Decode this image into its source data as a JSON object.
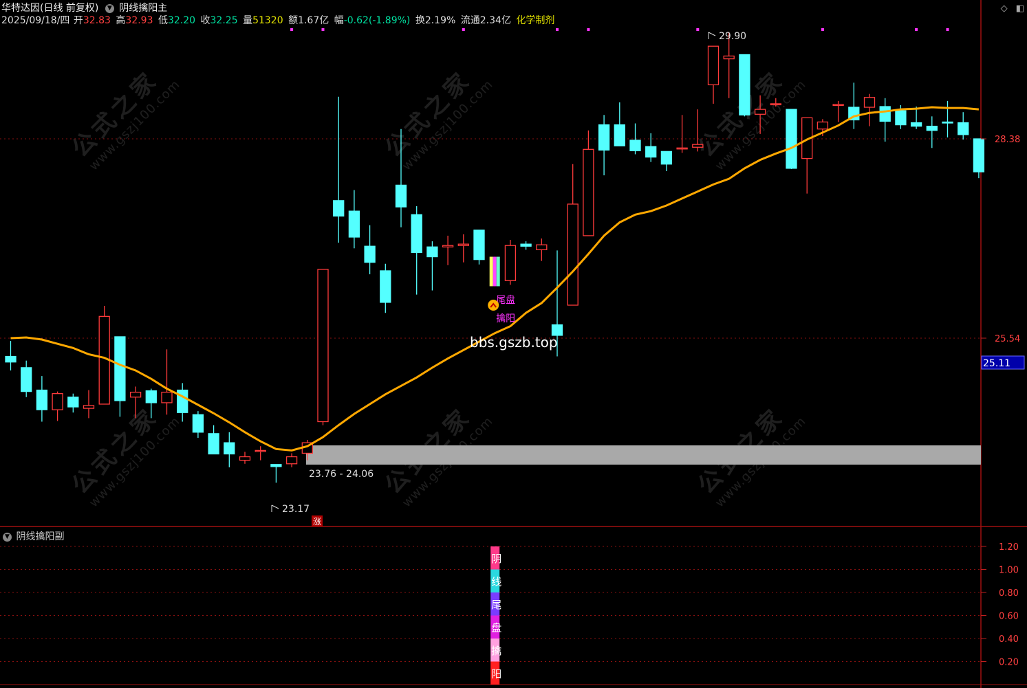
{
  "header": {
    "stock_name": "华特达因(日线 前复权)",
    "indicator_name": "阴线擒阳主",
    "date": "2025/09/18/四",
    "open_label": "开",
    "open": "32.83",
    "high_label": "高",
    "high": "32.93",
    "low_label": "低",
    "low": "32.20",
    "close_label": "收",
    "close": "32.25",
    "volume_label": "量",
    "volume": "51320",
    "amount_label": "额",
    "amount": "1.67亿",
    "change_label": "幅",
    "change": "-0.62(-1.89%)",
    "turnover_label": "换",
    "turnover": "2.19%",
    "float_label": "流通",
    "float": "2.34亿",
    "sector": "化学制剂",
    "icons": [
      "diamond-icon",
      "window-icon"
    ]
  },
  "watermark": {
    "cn": "公式之家",
    "url": "www.gszj100.com"
  },
  "overlay_text": "bbs.gszb.top",
  "sub_panel": {
    "title": "阴线擒阳副"
  },
  "colors": {
    "up": "#ff3b3b",
    "down": "#54ffff",
    "ma": "#ffa800",
    "grid": "#8a1010",
    "magenta": "#ff33ff"
  },
  "chart_data": [
    {
      "type": "candlestick",
      "title": "",
      "y_ticks": [
        "28.38",
        "25.54"
      ],
      "current_price_tag": "25.11",
      "annotations": {
        "high_mark": "29.90",
        "low_mark": "23.17",
        "zone_label": "23.76 - 24.06",
        "signal_top": "尾盘",
        "signal_bottom": "擒阳",
        "limit_up_tag": "涨"
      },
      "zone": [
        23.76,
        24.06
      ],
      "candles": [
        {
          "o": 25.28,
          "h": 25.5,
          "l": 25.08,
          "c": 25.2
        },
        {
          "o": 25.12,
          "h": 25.22,
          "l": 24.7,
          "c": 24.78
        },
        {
          "o": 24.8,
          "h": 25.0,
          "l": 24.35,
          "c": 24.52
        },
        {
          "o": 24.52,
          "h": 24.78,
          "l": 24.36,
          "c": 24.75
        },
        {
          "o": 24.7,
          "h": 24.75,
          "l": 24.48,
          "c": 24.56
        },
        {
          "o": 24.54,
          "h": 24.8,
          "l": 24.4,
          "c": 24.58
        },
        {
          "o": 24.6,
          "h": 26.0,
          "l": 24.6,
          "c": 25.85
        },
        {
          "o": 25.56,
          "h": 25.56,
          "l": 24.42,
          "c": 24.65
        },
        {
          "o": 24.7,
          "h": 24.85,
          "l": 24.4,
          "c": 24.77
        },
        {
          "o": 24.79,
          "h": 24.82,
          "l": 24.4,
          "c": 24.62
        },
        {
          "o": 24.62,
          "h": 25.38,
          "l": 24.45,
          "c": 24.77
        },
        {
          "o": 24.8,
          "h": 24.9,
          "l": 24.35,
          "c": 24.48
        },
        {
          "o": 24.45,
          "h": 24.5,
          "l": 24.12,
          "c": 24.2
        },
        {
          "o": 24.18,
          "h": 24.3,
          "l": 23.98,
          "c": 23.89
        },
        {
          "o": 24.05,
          "h": 24.2,
          "l": 23.7,
          "c": 23.89
        },
        {
          "o": 23.8,
          "h": 23.92,
          "l": 23.75,
          "c": 23.85
        },
        {
          "o": 23.94,
          "h": 24.0,
          "l": 23.8,
          "c": 23.94
        },
        {
          "o": 23.74,
          "h": 23.74,
          "l": 23.48,
          "c": 23.71
        },
        {
          "o": 23.75,
          "h": 23.9,
          "l": 23.7,
          "c": 23.85
        },
        {
          "o": 23.9,
          "h": 24.09,
          "l": 23.8,
          "c": 24.05
        },
        {
          "o": 24.35,
          "h": 26.52,
          "l": 24.3,
          "c": 26.52
        },
        {
          "o": 27.5,
          "h": 28.98,
          "l": 26.9,
          "c": 27.28
        },
        {
          "o": 27.35,
          "h": 27.65,
          "l": 26.82,
          "c": 26.98
        },
        {
          "o": 26.85,
          "h": 27.15,
          "l": 26.45,
          "c": 26.62
        },
        {
          "o": 26.5,
          "h": 26.6,
          "l": 25.9,
          "c": 26.05
        },
        {
          "o": 27.72,
          "h": 28.52,
          "l": 27.12,
          "c": 27.41
        },
        {
          "o": 27.3,
          "h": 27.42,
          "l": 26.16,
          "c": 26.76
        },
        {
          "o": 26.84,
          "h": 26.92,
          "l": 26.22,
          "c": 26.7
        },
        {
          "o": 26.84,
          "h": 27.0,
          "l": 26.58,
          "c": 26.86
        },
        {
          "o": 26.86,
          "h": 27.02,
          "l": 26.62,
          "c": 26.88
        },
        {
          "o": 27.08,
          "h": 27.08,
          "l": 26.59,
          "c": 26.66
        },
        {
          "o": 26.7,
          "h": 26.7,
          "l": 26.28,
          "c": 26.28
        },
        {
          "o": 26.36,
          "h": 26.94,
          "l": 26.3,
          "c": 26.86
        },
        {
          "o": 26.88,
          "h": 26.92,
          "l": 26.8,
          "c": 26.85
        },
        {
          "o": 26.8,
          "h": 26.96,
          "l": 26.64,
          "c": 26.87
        },
        {
          "o": 25.73,
          "h": 26.79,
          "l": 25.28,
          "c": 25.58
        },
        {
          "o": 26.01,
          "h": 28.02,
          "l": 26.02,
          "c": 27.45
        },
        {
          "o": 27.0,
          "h": 28.5,
          "l": 27.0,
          "c": 28.23
        },
        {
          "o": 28.58,
          "h": 28.72,
          "l": 27.86,
          "c": 28.22
        },
        {
          "o": 28.58,
          "h": 28.9,
          "l": 28.38,
          "c": 28.28
        },
        {
          "o": 28.36,
          "h": 28.6,
          "l": 28.16,
          "c": 28.21
        },
        {
          "o": 28.27,
          "h": 28.46,
          "l": 28.05,
          "c": 28.12
        },
        {
          "o": 28.2,
          "h": 28.2,
          "l": 27.92,
          "c": 28.02
        },
        {
          "o": 28.24,
          "h": 28.72,
          "l": 28.18,
          "c": 28.25
        },
        {
          "o": 28.26,
          "h": 28.8,
          "l": 28.2,
          "c": 28.3
        },
        {
          "o": 29.15,
          "h": 29.6,
          "l": 28.88,
          "c": 29.7
        },
        {
          "o": 29.52,
          "h": 29.9,
          "l": 28.96,
          "c": 29.56
        },
        {
          "o": 29.58,
          "h": 29.58,
          "l": 28.7,
          "c": 28.72
        },
        {
          "o": 28.73,
          "h": 29.0,
          "l": 28.45,
          "c": 28.8
        },
        {
          "o": 28.87,
          "h": 28.96,
          "l": 28.84,
          "c": 28.88
        },
        {
          "o": 28.8,
          "h": 28.8,
          "l": 27.95,
          "c": 27.96
        },
        {
          "o": 28.1,
          "h": 28.56,
          "l": 27.6,
          "c": 28.68
        },
        {
          "o": 28.52,
          "h": 28.66,
          "l": 28.42,
          "c": 28.62
        },
        {
          "o": 28.87,
          "h": 28.92,
          "l": 28.62,
          "c": 28.87
        },
        {
          "o": 28.83,
          "h": 29.18,
          "l": 28.52,
          "c": 28.65
        },
        {
          "o": 28.83,
          "h": 29.02,
          "l": 28.56,
          "c": 28.97
        },
        {
          "o": 28.84,
          "h": 28.96,
          "l": 28.34,
          "c": 28.63
        },
        {
          "o": 28.78,
          "h": 28.86,
          "l": 28.52,
          "c": 28.58
        },
        {
          "o": 28.61,
          "h": 28.84,
          "l": 28.52,
          "c": 28.56
        },
        {
          "o": 28.56,
          "h": 28.7,
          "l": 28.25,
          "c": 28.5
        },
        {
          "o": 28.62,
          "h": 28.92,
          "l": 28.4,
          "c": 28.61
        },
        {
          "o": 28.61,
          "h": 28.76,
          "l": 28.37,
          "c": 28.44
        },
        {
          "o": 28.38,
          "h": 28.38,
          "l": 27.82,
          "c": 27.91
        }
      ],
      "ma_line": [
        25.54,
        25.55,
        25.52,
        25.46,
        25.4,
        25.31,
        25.26,
        25.16,
        25.08,
        24.96,
        24.82,
        24.71,
        24.59,
        24.47,
        24.34,
        24.2,
        24.07,
        23.96,
        23.94,
        24.0,
        24.13,
        24.3,
        24.46,
        24.6,
        24.74,
        24.86,
        24.98,
        25.12,
        25.25,
        25.37,
        25.49,
        25.61,
        25.71,
        25.9,
        26.04,
        26.26,
        26.49,
        26.74,
        27.0,
        27.19,
        27.3,
        27.35,
        27.43,
        27.53,
        27.63,
        27.73,
        27.81,
        27.96,
        28.08,
        28.17,
        28.25,
        28.37,
        28.47,
        28.57,
        28.7,
        28.75,
        28.77,
        28.8,
        28.81,
        28.83,
        28.82,
        28.82,
        28.8
      ],
      "signal_index": 31,
      "top_marker_indices": [
        18,
        20,
        29,
        35,
        37,
        44,
        52,
        58,
        60
      ]
    },
    {
      "type": "bar",
      "title": "阴线擒阳副",
      "y_ticks": [
        "1.20",
        "1.00",
        "0.80",
        "0.60",
        "0.40",
        "0.20"
      ],
      "ylim": [
        0,
        1.3
      ],
      "signal_index": 31,
      "value": 1.2,
      "segments": [
        "阴",
        "线",
        "尾",
        "盘",
        "擒",
        "阳"
      ]
    }
  ]
}
